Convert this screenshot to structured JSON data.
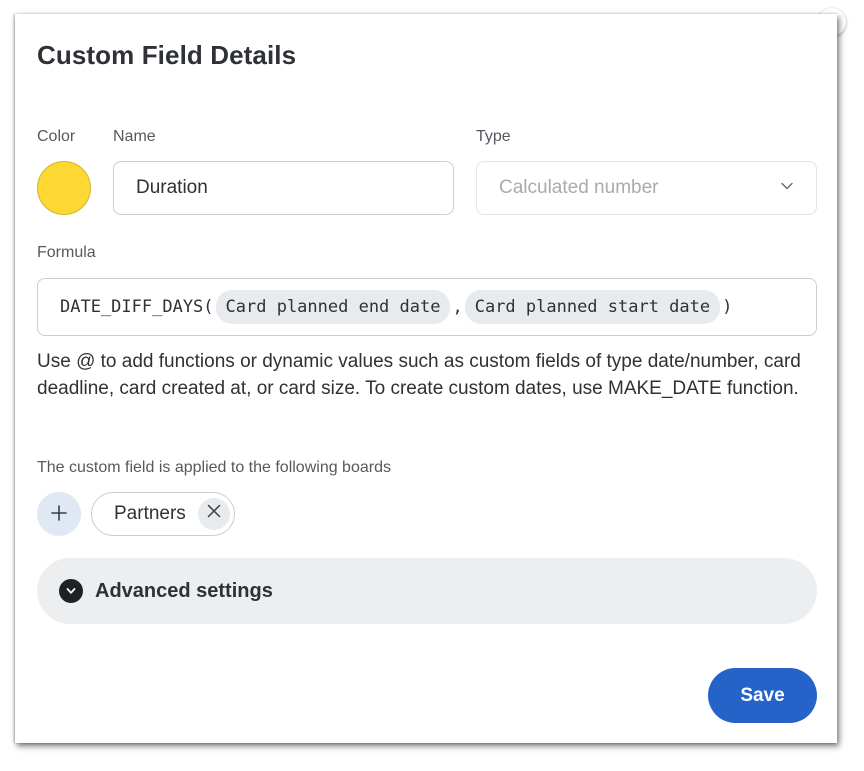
{
  "dialog": {
    "title": "Custom Field Details"
  },
  "color": {
    "label": "Color",
    "value": "#fdd835"
  },
  "name": {
    "label": "Name",
    "value": "Duration"
  },
  "type": {
    "label": "Type",
    "selected": "Calculated number",
    "icon": "chevron-down-icon"
  },
  "formula": {
    "label": "Formula",
    "function_open": "DATE_DIFF_DAYS(",
    "arg1": "Card planned end date",
    "separator": ",",
    "arg2": "Card planned start date",
    "function_close": ")",
    "help_text": "Use @ to add functions or dynamic values such as custom fields of type date/number, card deadline, card created at, or card size. To create custom dates, use MAKE_DATE function."
  },
  "boards": {
    "label": "The custom field is applied to the following boards",
    "add_icon": "plus-icon",
    "items": [
      {
        "label": "Partners",
        "remove_icon": "close-icon"
      }
    ]
  },
  "advanced": {
    "label": "Advanced settings",
    "icon": "chevron-down-circle-icon"
  },
  "actions": {
    "save_label": "Save",
    "save_color": "#2563c9"
  }
}
